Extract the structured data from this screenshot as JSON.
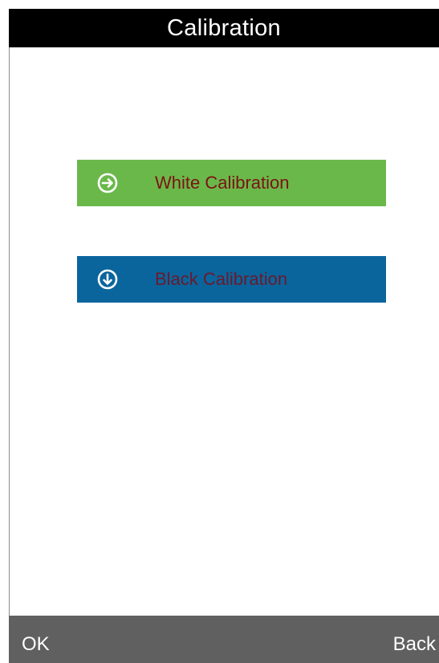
{
  "screen": {
    "title": "Calibration"
  },
  "buttons": {
    "white": {
      "label": "White Calibration",
      "icon": "arrow-right-circle-icon",
      "color": "#6bb84a"
    },
    "black": {
      "label": "Black Calibration",
      "icon": "arrow-down-circle-icon",
      "color": "#0a659d"
    }
  },
  "softkeys": {
    "ok_label": "OK",
    "back_label": "Back"
  }
}
